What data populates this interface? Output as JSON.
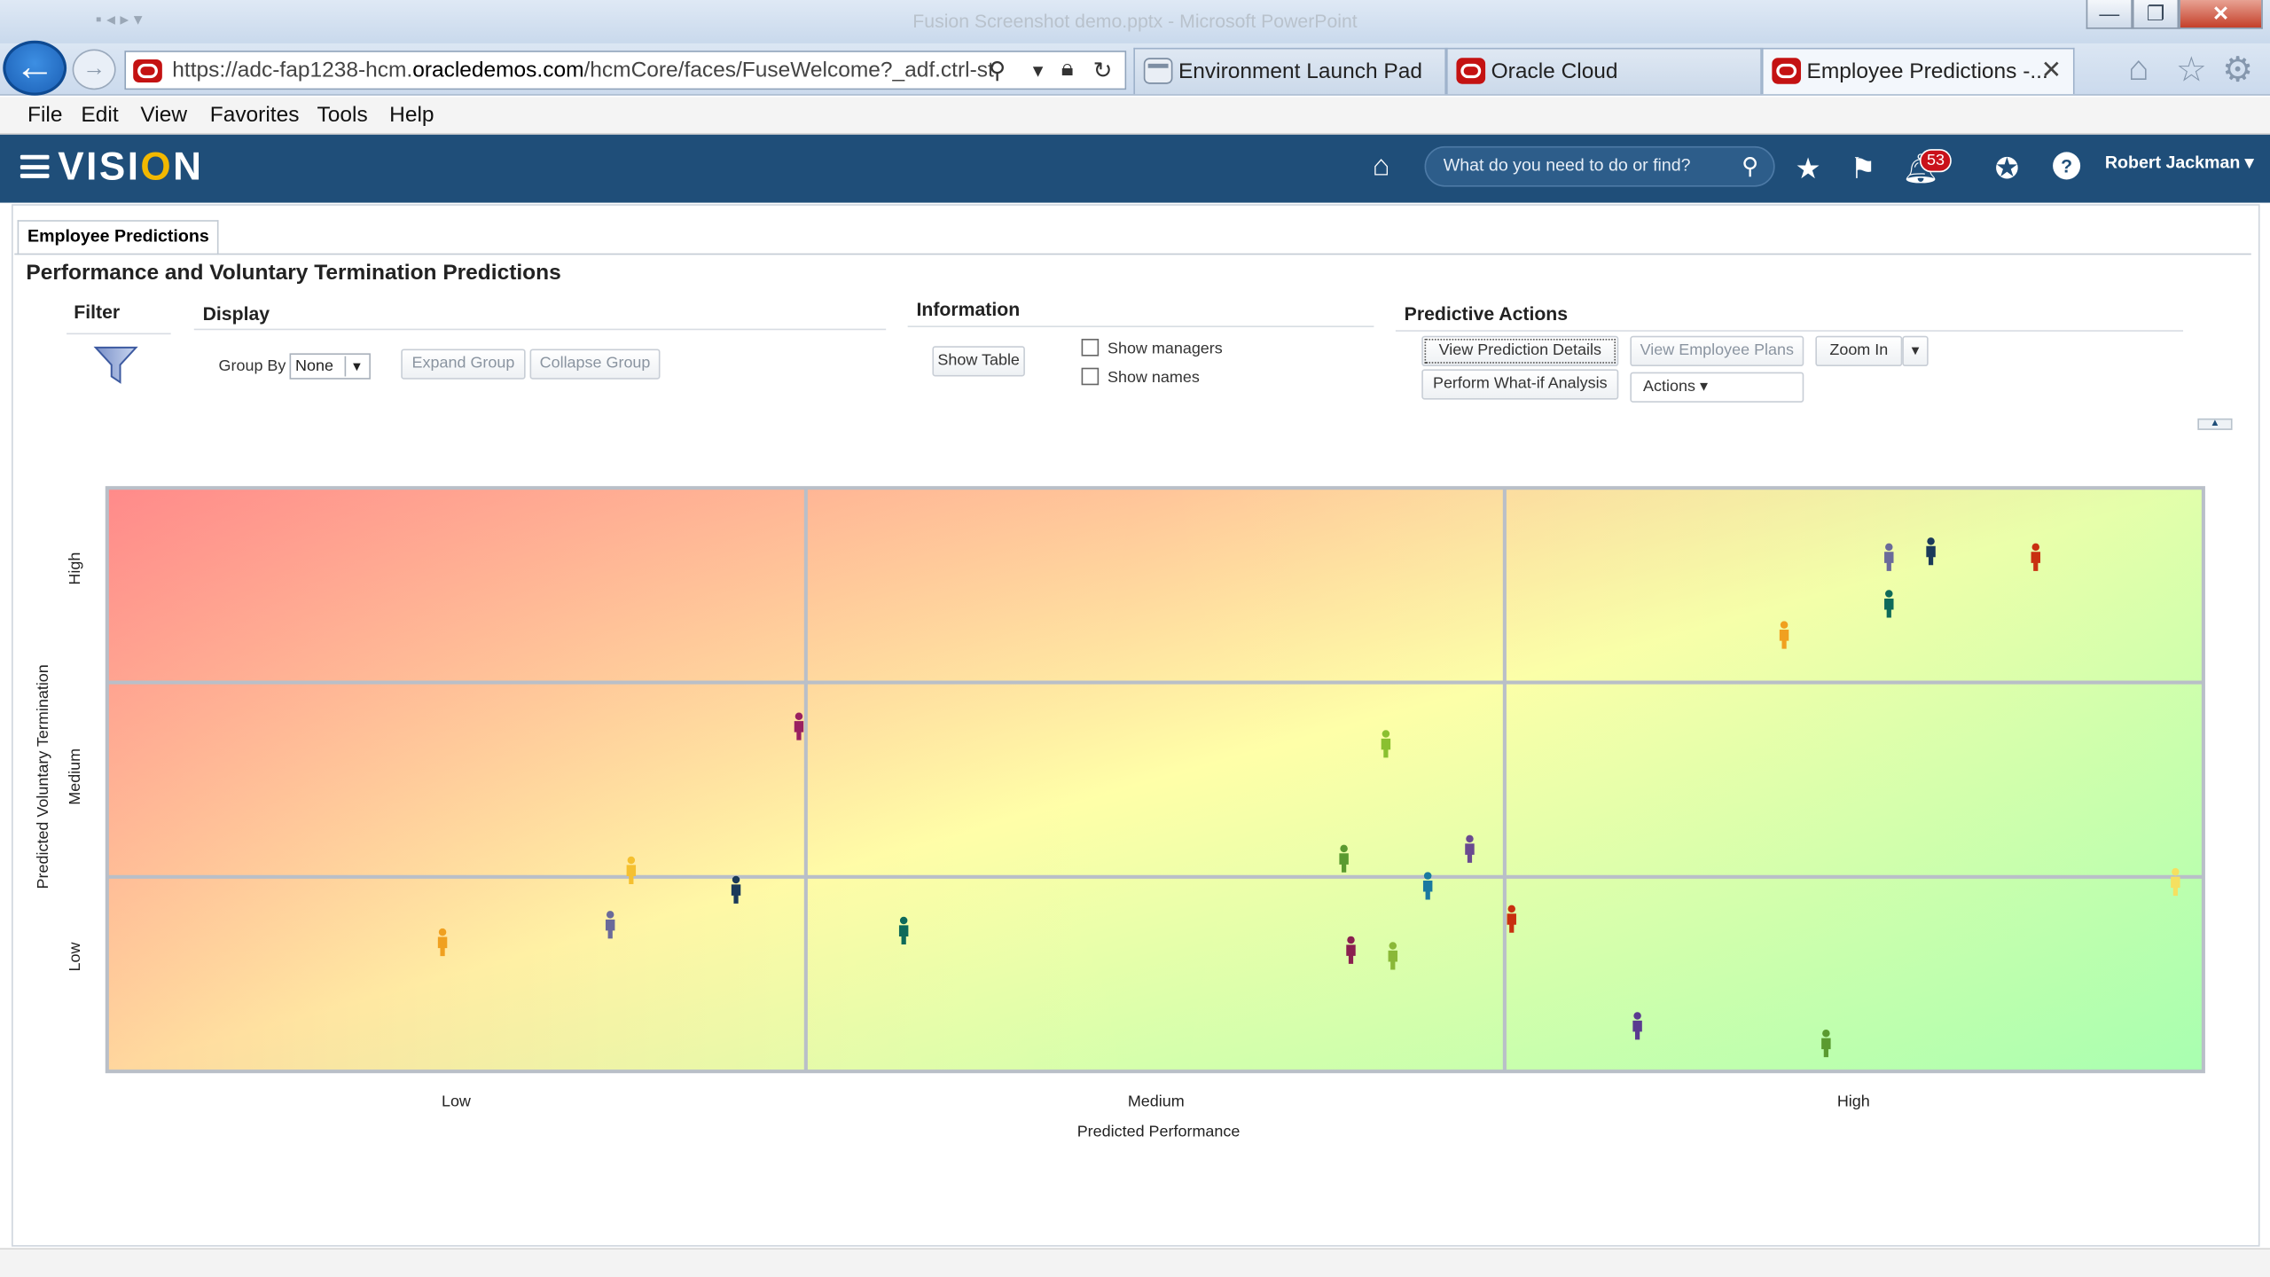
{
  "window": {
    "title": "Fusion Screenshot demo.pptx - Microsoft PowerPoint",
    "minimize": "—",
    "restore": "❐",
    "close": "✕"
  },
  "browser": {
    "url_prefix": "https://adc-fap1238-hcm.",
    "url_domain": "oracledemos.com",
    "url_suffix": "/hcmCore/faces/FuseWelcome?_adf.ctrl-st",
    "tabs": [
      {
        "label": "Environment Launch Pad",
        "icon": "page-icon"
      },
      {
        "label": "Oracle Cloud",
        "icon": "oracle-icon"
      },
      {
        "label": "Employee Predictions -...",
        "icon": "oracle-icon",
        "active": true
      }
    ],
    "menu": [
      "File",
      "Edit",
      "View",
      "Favorites",
      "Tools",
      "Help"
    ]
  },
  "app": {
    "logo_pre": "VISI",
    "logo_dot": "O",
    "logo_post": "N",
    "search_placeholder": "What do you need to do or find?",
    "notification_count": "53",
    "user_name": "Robert Jackman ▾"
  },
  "page": {
    "tab_label": "Employee Predictions",
    "title": "Performance and Voluntary Termination Predictions",
    "filter": {
      "header": "Filter"
    },
    "display": {
      "header": "Display",
      "group_by_label": "Group By",
      "group_by_value": "None",
      "expand_label": "Expand Group",
      "collapse_label": "Collapse Group"
    },
    "information": {
      "header": "Information",
      "show_table_label": "Show Table",
      "show_managers_label": "Show managers",
      "show_names_label": "Show names"
    },
    "predictive_actions": {
      "header": "Predictive Actions",
      "view_details_label": "View Prediction Details",
      "view_plans_label": "View Employee Plans",
      "zoom_label": "Zoom In",
      "what_if_label": "Perform What-if Analysis",
      "actions_label": "Actions ▾"
    }
  },
  "chart_data": {
    "type": "scatter",
    "xlabel": "Predicted Performance",
    "ylabel": "Predicted Voluntary Termination",
    "x_categories": [
      "Low",
      "Medium",
      "High"
    ],
    "y_categories": [
      "Low",
      "Medium",
      "High"
    ],
    "xlim": [
      0,
      3
    ],
    "ylim": [
      0,
      3
    ],
    "grid": true,
    "points": [
      {
        "x": 0.48,
        "y": 0.66,
        "color": "#f0a020"
      },
      {
        "x": 0.72,
        "y": 0.75,
        "color": "#6a6a9a"
      },
      {
        "x": 0.75,
        "y": 1.03,
        "color": "#f5c030"
      },
      {
        "x": 0.9,
        "y": 0.93,
        "color": "#1b3a5a"
      },
      {
        "x": 0.99,
        "y": 1.77,
        "color": "#9a2060"
      },
      {
        "x": 1.14,
        "y": 0.72,
        "color": "#0e6a5a"
      },
      {
        "x": 1.78,
        "y": 0.62,
        "color": "#8a2050"
      },
      {
        "x": 1.84,
        "y": 0.59,
        "color": "#8ab838"
      },
      {
        "x": 1.83,
        "y": 1.68,
        "color": "#8ac030"
      },
      {
        "x": 1.77,
        "y": 1.09,
        "color": "#5a9a30"
      },
      {
        "x": 1.89,
        "y": 0.95,
        "color": "#1a7aa0"
      },
      {
        "x": 1.95,
        "y": 1.14,
        "color": "#6a4a90"
      },
      {
        "x": 2.01,
        "y": 0.78,
        "color": "#c83010"
      },
      {
        "x": 2.19,
        "y": 0.23,
        "color": "#5a3a90"
      },
      {
        "x": 2.46,
        "y": 0.14,
        "color": "#5a9a30"
      },
      {
        "x": 2.4,
        "y": 2.24,
        "color": "#f0a020"
      },
      {
        "x": 2.55,
        "y": 2.4,
        "color": "#0e6a5a"
      },
      {
        "x": 2.55,
        "y": 2.64,
        "color": "#6a6a9a"
      },
      {
        "x": 2.61,
        "y": 2.67,
        "color": "#1b3a5a"
      },
      {
        "x": 2.76,
        "y": 2.64,
        "color": "#c83010"
      },
      {
        "x": 2.96,
        "y": 0.97,
        "color": "#f5e060"
      }
    ]
  },
  "colors": {
    "app_header": "#1f4e79",
    "zone_risk": "#ff8a8a",
    "zone_mid": "#ffffa8",
    "zone_good": "#a8ffb0"
  }
}
